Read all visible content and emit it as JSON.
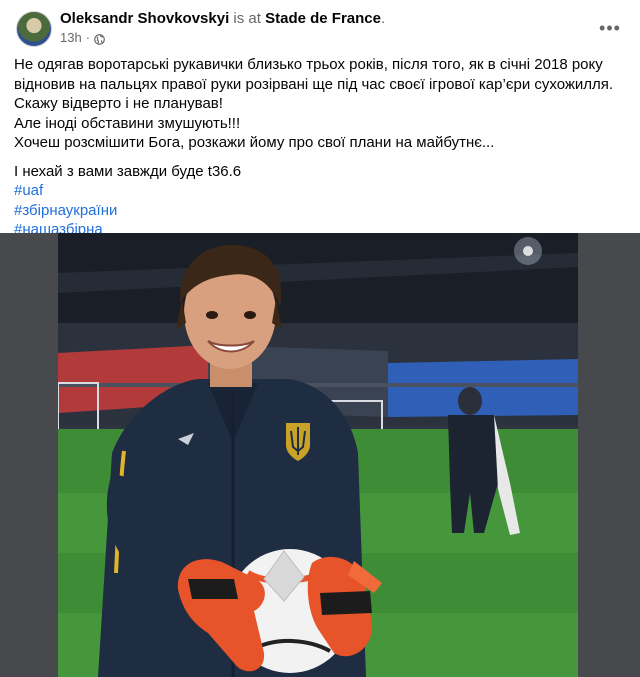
{
  "post": {
    "author": "Oleksandr Shovkovskyi",
    "is_at": " is at ",
    "place": "Stade de France",
    "place_suffix": ".",
    "time": "13h",
    "time_sep": "·",
    "more_label": "•••",
    "text_lines": [
      "Не одягав воротарські рукавички близько трьох років, після того, як в січні 2018 року відновив на пальцях правої руки розірвані ще під час своєї ігрової кар’єри сухожилля.",
      "Скажу відверто і не планував!",
      "Але іноді обставини змушують!!!",
      "Хочеш розсмішити Бога, розкажи йому про свої плани на майбутнє..."
    ],
    "closing_line": "І нехай з вами завжди буде t36.6",
    "hashtags": [
      "#uaf",
      "#збірнаукраїни",
      "#нашазбірна"
    ]
  },
  "colors": {
    "link": "#216fdb",
    "secondary_text": "#65676b",
    "photo_letterbox": "#47494d",
    "jacket": "#1f2d42",
    "glove": "#e8542a"
  },
  "icons": [
    "avatar",
    "globe-icon",
    "more-icon",
    "trident-crest-icon"
  ]
}
